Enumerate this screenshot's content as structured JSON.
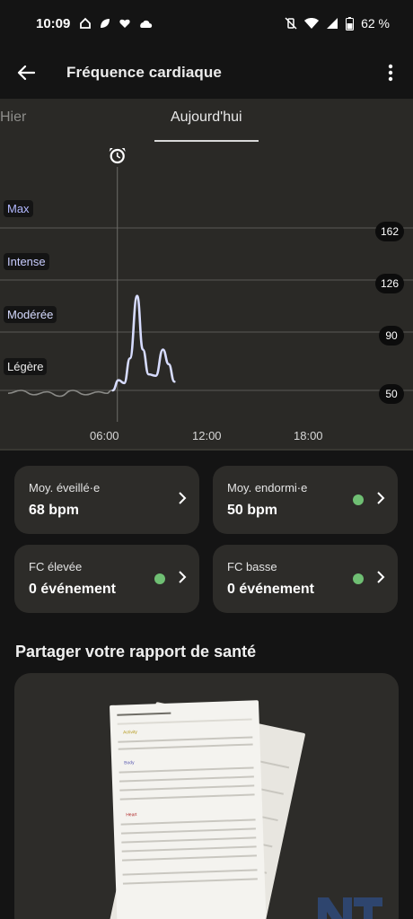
{
  "status_bar": {
    "time": "10:09",
    "battery": "62 %",
    "left_icons": [
      "home-icon",
      "leaf-icon",
      "heart-icon",
      "cloud-icon"
    ],
    "right_icons": [
      "vibrate-off-icon",
      "wifi-icon",
      "signal-icon",
      "battery-icon"
    ]
  },
  "app_bar": {
    "title": "Fréquence cardiaque"
  },
  "tabs": {
    "yesterday": "Hier",
    "today": "Aujourd'hui",
    "selected": "today"
  },
  "chart_data": {
    "type": "line",
    "title": "",
    "zones": [
      "Max",
      "Intense",
      "Modérée",
      "Légère"
    ],
    "y_reference_lines": [
      162,
      126,
      90,
      50
    ],
    "x_ticks": [
      "06:00",
      "12:00",
      "18:00"
    ],
    "wake_marker_time": "06:21",
    "series": [
      {
        "name": "sleep",
        "x": [
          "00:00",
          "00:45",
          "01:30",
          "02:15",
          "03:00",
          "03:45",
          "04:30",
          "05:15",
          "05:45",
          "06:00"
        ],
        "y": [
          48,
          50,
          47,
          49,
          46,
          50,
          47,
          49,
          48,
          50
        ]
      },
      {
        "name": "awake",
        "x": [
          "06:05",
          "06:25",
          "06:45",
          "07:05",
          "07:30",
          "07:50",
          "08:10",
          "08:35",
          "09:00",
          "09:20",
          "09:40"
        ],
        "y": [
          50,
          57,
          55,
          72,
          115,
          78,
          61,
          60,
          78,
          68,
          56
        ]
      }
    ],
    "colors": {
      "sleep": "#8a8a87",
      "awake": "#d7dcff"
    }
  },
  "cards": [
    {
      "label": "Moy. éveillé·e",
      "value": "68 bpm",
      "dot": false
    },
    {
      "label": "Moy. endormi·e",
      "value": "50 bpm",
      "dot": true
    },
    {
      "label": "FC élevée",
      "value": "0 événement",
      "dot": true
    },
    {
      "label": "FC basse",
      "value": "0 événement",
      "dot": true
    }
  ],
  "share": {
    "title": "Partager votre rapport de santé",
    "doc_sections": [
      "Activity",
      "Body",
      "Heart"
    ]
  },
  "colors": {
    "background": "#141414",
    "panel": "#2a2926",
    "card": "#2d2c29",
    "accent_dot": "#6fbf73",
    "line_awake": "#d7dcff"
  }
}
